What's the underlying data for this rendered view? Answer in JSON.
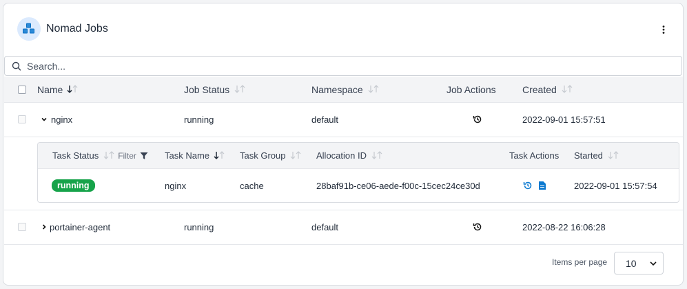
{
  "header": {
    "title": "Nomad Jobs",
    "logo_icon": "cubes-icon",
    "menu_icon": "kebab-menu-icon"
  },
  "search": {
    "placeholder": "Search..."
  },
  "columns": {
    "name": "Name",
    "job_status": "Job Status",
    "namespace": "Namespace",
    "job_actions": "Job Actions",
    "created": "Created"
  },
  "jobs": [
    {
      "name": "nginx",
      "expanded": true,
      "status": "running",
      "namespace": "default",
      "created": "2022-09-01 15:57:51"
    },
    {
      "name": "portainer-agent",
      "expanded": false,
      "status": "running",
      "namespace": "default",
      "created": "2022-08-22 16:06:28"
    }
  ],
  "task_columns": {
    "task_status": "Task Status",
    "filter": "Filter",
    "task_name": "Task Name",
    "task_group": "Task Group",
    "allocation_id": "Allocation ID",
    "task_actions": "Task Actions",
    "started": "Started"
  },
  "tasks": [
    {
      "status": "running",
      "name": "nginx",
      "group": "cache",
      "allocation_id": "28baf91b-ce06-aede-f00c-15cec24ce30d",
      "started": "2022-09-01 15:57:54"
    }
  ],
  "pagination": {
    "items_per_page_label": "Items per page",
    "items_per_page": "10"
  },
  "colors": {
    "accent": "#0b79d0",
    "running_badge": "#16a34a",
    "header_bg": "#f3f4f6"
  }
}
